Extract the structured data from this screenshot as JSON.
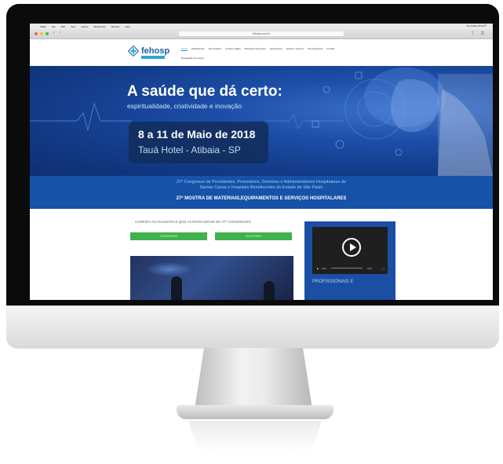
{
  "browser": {
    "menu_items": [
      "Safari",
      "File",
      "Edit",
      "View",
      "History",
      "Bookmarks",
      "Window",
      "Help"
    ],
    "url": "fehosp.com.br",
    "nav_arrows": "‹ ›",
    "status_right": "Tue 8 May 15:40 ☰"
  },
  "site": {
    "logo_text": "fehosp",
    "nav_items": [
      "Home",
      "Palestrantes",
      "Informações",
      "A Feira / Mapa",
      "Manual do Expositor",
      "Expositores",
      "Hotéis e Turismo",
      "Pré-Programa",
      "Contato"
    ],
    "nav_second_line": "Divulgação do evento",
    "hero_title": "A saúde que dá certo:",
    "hero_subtitle": "espiritualidade, criatividade e inovação",
    "event_date": "8 a 11 de Maio de 2018",
    "event_venue": "Tauá Hotel - Atibaia - SP",
    "banner_line1": "27º Congresso de Presidentes, Provedores, Diretores e Administradores Hospitalares de",
    "banner_line2": "Santas Casas e Hospitais Beneficentes do Estado de São Paulo",
    "banner_line3": "27ª MOSTRA DE MATERIAIS,EQUIPAMENTOS E SERVIÇOS HOSPITALARES",
    "confira_text": "CONFIRA AS PALESTRAS QUE ACONTECERAM NO 27º CONGRESSO",
    "button_a": "CONGRESSO",
    "button_b": "PALESTRAS",
    "video_time_start": "0:00",
    "video_time_end": "0:00",
    "video_caption": "PROFISSIONAIS E"
  },
  "colors": {
    "hero_blue": "#1c4da6",
    "banner_blue": "#1552a8",
    "button_green": "#3fb24a",
    "logo_blue": "#1b5fa0"
  }
}
